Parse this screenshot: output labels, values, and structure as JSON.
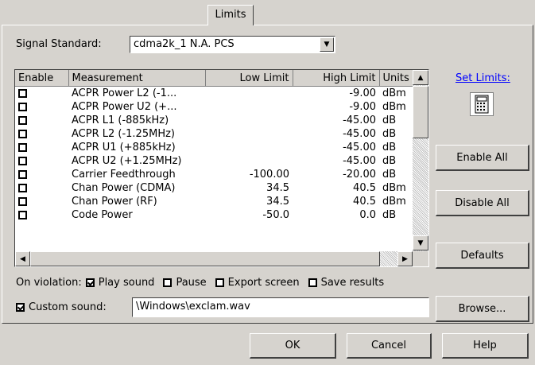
{
  "tab": {
    "label": "Limits"
  },
  "signal": {
    "label": "Signal Standard:",
    "value": "cdma2k_1 N.A. PCS"
  },
  "table": {
    "headers": {
      "enable": "Enable",
      "measurement": "Measurement",
      "low": "Low Limit",
      "high": "High Limit",
      "units": "Units"
    },
    "rows": [
      {
        "enabled": false,
        "measurement": "ACPR  Power L2 (-1...",
        "low": "",
        "high": "-9.00",
        "units": "dBm"
      },
      {
        "enabled": false,
        "measurement": "ACPR  Power U2 (+...",
        "low": "",
        "high": "-9.00",
        "units": "dBm"
      },
      {
        "enabled": false,
        "measurement": "ACPR L1 (-885kHz)",
        "low": "",
        "high": "-45.00",
        "units": "dB"
      },
      {
        "enabled": false,
        "measurement": "ACPR L2 (-1.25MHz)",
        "low": "",
        "high": "-45.00",
        "units": "dB"
      },
      {
        "enabled": false,
        "measurement": "ACPR U1 (+885kHz)",
        "low": "",
        "high": "-45.00",
        "units": "dB"
      },
      {
        "enabled": false,
        "measurement": "ACPR U2 (+1.25MHz)",
        "low": "",
        "high": "-45.00",
        "units": "dB"
      },
      {
        "enabled": false,
        "measurement": "Carrier Feedthrough",
        "low": "-100.00",
        "high": "-20.00",
        "units": "dB"
      },
      {
        "enabled": false,
        "measurement": "Chan Power (CDMA)",
        "low": "34.5",
        "high": "40.5",
        "units": "dBm"
      },
      {
        "enabled": false,
        "measurement": "Chan Power (RF)",
        "low": "34.5",
        "high": "40.5",
        "units": "dBm"
      },
      {
        "enabled": false,
        "measurement": "Code Power",
        "low": "-50.0",
        "high": "0.0",
        "units": "dB"
      }
    ]
  },
  "side": {
    "set_limits": "Set Limits:",
    "enable_all": "Enable All",
    "disable_all": "Disable All",
    "defaults": "Defaults",
    "browse": "Browse..."
  },
  "violation": {
    "label": "On violation:",
    "play_sound": {
      "label": "Play sound",
      "checked": true
    },
    "pause": {
      "label": "Pause",
      "checked": false
    },
    "export_screen": {
      "label": "Export screen",
      "checked": false
    },
    "save_results": {
      "label": "Save results",
      "checked": false
    }
  },
  "custom_sound": {
    "label": "Custom sound:",
    "checked": true,
    "path": "\\Windows\\exclam.wav"
  },
  "footer": {
    "ok": "OK",
    "cancel": "Cancel",
    "help": "Help"
  }
}
